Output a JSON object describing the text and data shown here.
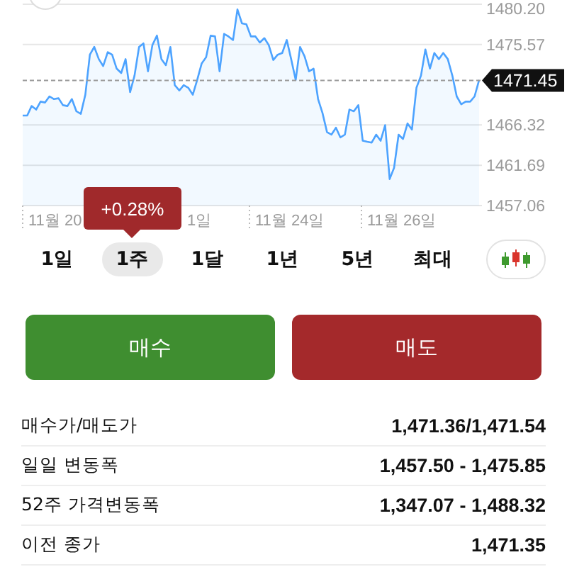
{
  "chart": {
    "chart_data": {
      "type": "area",
      "series": [
        {
          "color": "#4da3ff",
          "values": [
            1467.4,
            1467.4,
            1468.5,
            1468.1,
            1469.0,
            1468.9,
            1469.6,
            1469.3,
            1469.4,
            1468.6,
            1468.5,
            1469.3,
            1467.9,
            1467.6,
            1469.8,
            1474.4,
            1475.3,
            1473.9,
            1473.1,
            1474.7,
            1474.4,
            1472.8,
            1472.3,
            1473.9,
            1470.1,
            1472.0,
            1475.3,
            1475.7,
            1472.5,
            1475.5,
            1476.6,
            1473.9,
            1473.2,
            1475.3,
            1470.9,
            1470.3,
            1470.9,
            1470.6,
            1469.8,
            1471.5,
            1473.4,
            1474.1,
            1476.6,
            1476.5,
            1472.5,
            1476.8,
            1476.5,
            1476.1,
            1479.6,
            1478.0,
            1477.9,
            1476.5,
            1476.5,
            1475.8,
            1476.3,
            1475.5,
            1473.8,
            1474.4,
            1474.6,
            1476.1,
            1473.9,
            1471.5,
            1475.3,
            1474.2,
            1472.5,
            1472.8,
            1469.3,
            1467.7,
            1465.5,
            1465.2,
            1466.0,
            1464.9,
            1465.2,
            1468.1,
            1467.9,
            1468.6,
            1464.5,
            1464.4,
            1464.3,
            1465.2,
            1464.5,
            1466.3,
            1460.1,
            1461.4,
            1465.2,
            1464.7,
            1466.5,
            1465.8,
            1470.6,
            1472.0,
            1475.0,
            1472.8,
            1474.6,
            1473.9,
            1474.6,
            1473.9,
            1472.0,
            1469.6,
            1468.7,
            1469.0,
            1469.0,
            1469.6,
            1471.5
          ]
        }
      ],
      "ylim": [
        1457.06,
        1480.2
      ],
      "yticks": [
        {
          "value": 1480.2,
          "label": "1480.20"
        },
        {
          "value": 1475.57,
          "label": "1475.57"
        },
        {
          "value": 1466.32,
          "label": "1466.32"
        },
        {
          "value": 1461.69,
          "label": "1461.69"
        },
        {
          "value": 1457.06,
          "label": "1457.06"
        }
      ],
      "grid": true
    },
    "current_price": "1471.45",
    "x_axis_labels": [
      "11월 20",
      "1일",
      "11월 24일",
      "11월 26일"
    ],
    "tooltip": "+0.28%"
  },
  "periods": [
    {
      "label": "1일",
      "selected": false
    },
    {
      "label": "1주",
      "selected": true
    },
    {
      "label": "1달",
      "selected": false
    },
    {
      "label": "1년",
      "selected": false
    },
    {
      "label": "5년",
      "selected": false
    },
    {
      "label": "최대",
      "selected": false
    }
  ],
  "trade_buttons": [
    {
      "kind": "buy",
      "label": "매수"
    },
    {
      "kind": "sell",
      "label": "매도"
    }
  ],
  "stats": [
    {
      "label": "매수가/매도가",
      "value": "1,471.36/1,471.54"
    },
    {
      "label": "일일 변동폭",
      "value": "1,457.50 - 1,475.85"
    },
    {
      "label": "52주 가격변동폭",
      "value": "1,347.07 - 1,488.32"
    },
    {
      "label": "이전 종가",
      "value": "1,471.35"
    }
  ]
}
